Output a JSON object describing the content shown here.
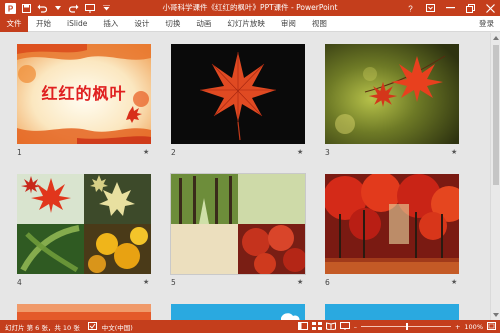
{
  "window": {
    "title": "小哥科学课件《红红的枫叶》PPT课件 - PowerPoint"
  },
  "ribbon": {
    "tabs": [
      {
        "label": "文件"
      },
      {
        "label": "开始"
      },
      {
        "label": "iSlide"
      },
      {
        "label": "插入"
      },
      {
        "label": "设计"
      },
      {
        "label": "切换"
      },
      {
        "label": "动画"
      },
      {
        "label": "幻灯片放映"
      },
      {
        "label": "审阅"
      },
      {
        "label": "视图"
      }
    ],
    "login_label": "登录"
  },
  "slides": [
    {
      "number": "1",
      "star": "★",
      "title": "红红的枫叶"
    },
    {
      "number": "2",
      "star": "★"
    },
    {
      "number": "3",
      "star": "★"
    },
    {
      "number": "4",
      "star": "★"
    },
    {
      "number": "5",
      "star": "★"
    },
    {
      "number": "6",
      "star": "★"
    }
  ],
  "status": {
    "slide_info": "幻灯片 第 6 张，共 10 张",
    "language": "中文(中国)",
    "zoom_minus": "–",
    "zoom_plus": "+",
    "zoom_level": "100%",
    "zoom_fraction": 0.5
  },
  "colors": {
    "accent": "#c43e1c",
    "slide_title": "#e02020"
  }
}
